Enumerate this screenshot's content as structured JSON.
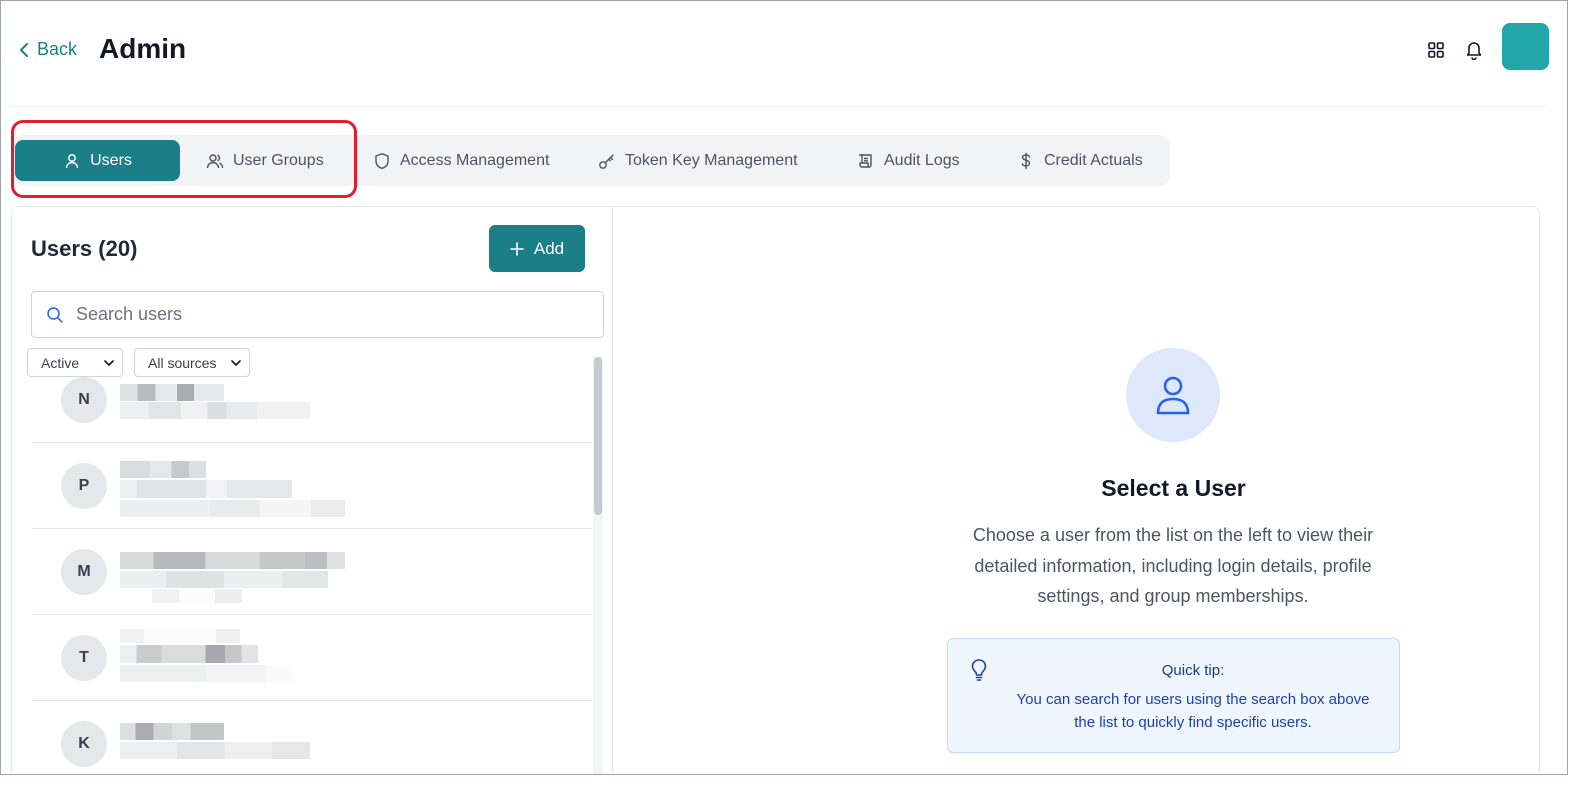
{
  "header": {
    "back_label": "Back",
    "title": "Admin"
  },
  "tabs": [
    {
      "label": "Users",
      "icon": "user-icon",
      "active": true
    },
    {
      "label": "User Groups",
      "icon": "users-icon",
      "active": false
    },
    {
      "label": "Access Management",
      "icon": "shield-icon",
      "active": false
    },
    {
      "label": "Token Key Management",
      "icon": "key-icon",
      "active": false
    },
    {
      "label": "Audit Logs",
      "icon": "scroll-icon",
      "active": false
    },
    {
      "label": "Credit Actuals",
      "icon": "dollar-icon",
      "active": false
    }
  ],
  "users_panel": {
    "title": "Users (20)",
    "add_label": "Add",
    "search_placeholder": "Search users",
    "status_filter": "Active",
    "source_filter": "All sources",
    "rows": [
      {
        "initial": "N"
      },
      {
        "initial": "P"
      },
      {
        "initial": "M"
      },
      {
        "initial": "T"
      },
      {
        "initial": "K"
      }
    ]
  },
  "detail_panel": {
    "title": "Select a User",
    "description": "Choose a user from the list on the left to view their detailed information, including login details, profile settings, and group memberships.",
    "tip_title": "Quick tip:",
    "tip_text": "You can search for users using the search box above the list to quickly find specific users."
  },
  "colors": {
    "accent": "#1a7f86",
    "highlight": "#e11d2e",
    "tip_background": "#eff6ff",
    "avatar": "#22a6a8"
  }
}
